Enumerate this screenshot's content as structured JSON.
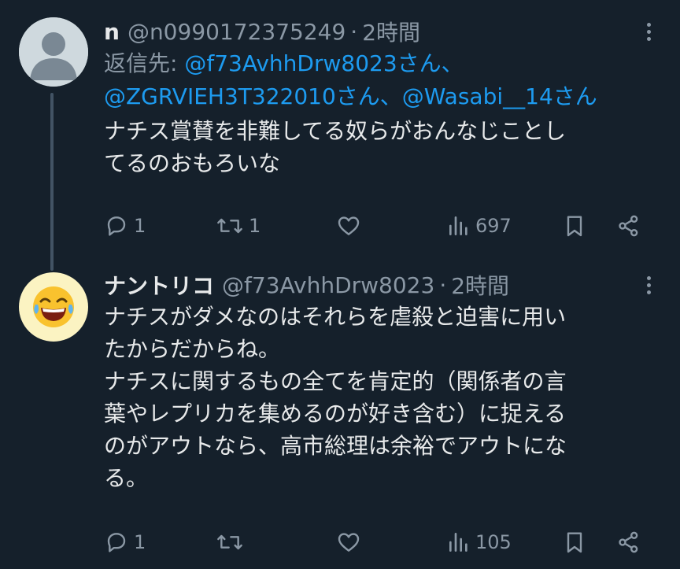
{
  "tweets": [
    {
      "display_name": "n",
      "handle": "@n0990172375249",
      "separator": "·",
      "time": "2時間",
      "reply_prefix": "返信先:",
      "reply_line1_mention": "@f73AvhhDrw8023さん、",
      "reply_line2_mention1": "@ZGRVIEH3T322010さん、",
      "reply_line2_mention2": "@Wasabi__14さん",
      "text_lines": [
        "ナチス賞賛を非難してる奴らがおんなじことし",
        "てるのおもろいな"
      ],
      "avatar_icon": "default-avatar-icon",
      "replies": "1",
      "retweets": "1",
      "likes": "",
      "views": "697"
    },
    {
      "display_name": "ナントリコ",
      "handle": "@f73AvhhDrw8023",
      "separator": "·",
      "time": "2時間",
      "text_lines": [
        "ナチスがダメなのはそれらを虐殺と迫害に用い",
        "たからだからね。",
        "ナチスに関するもの全てを肯定的（関係者の言",
        "葉やレプリカを集めるのが好き含む）に捉える",
        "のがアウトなら、高市総理は余裕でアウトにな",
        "る。"
      ],
      "avatar_emoji": "😂",
      "avatar_icon": "laughing-emoji-avatar",
      "replies": "1",
      "retweets": "",
      "likes": "",
      "views": "105"
    }
  ],
  "colors": {
    "background": "#15202b",
    "text": "#e7e9ea",
    "muted": "#8b98a5",
    "link": "#1d9bf0",
    "thread_line": "#425364"
  }
}
